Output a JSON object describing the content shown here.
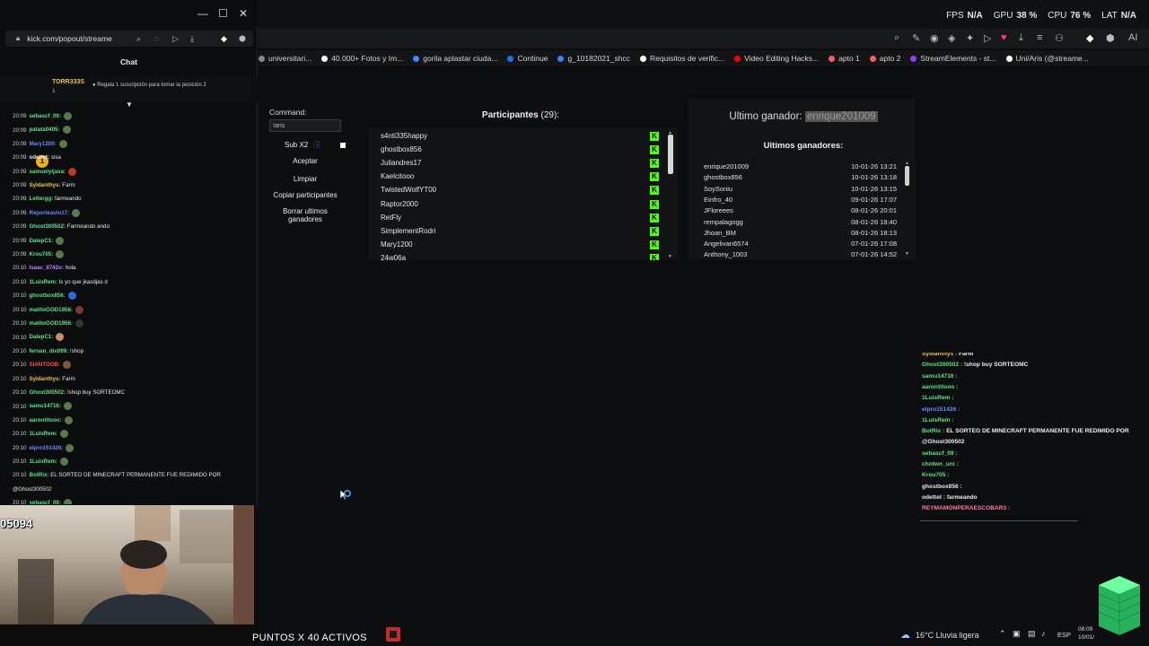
{
  "perf": [
    {
      "label": "FPS",
      "value": "N/A"
    },
    {
      "label": "GPU",
      "value": "38 %"
    },
    {
      "label": "CPU",
      "value": "76 %"
    },
    {
      "label": "LAT",
      "value": "N/A"
    }
  ],
  "bookmarks": [
    {
      "label": "universitari...",
      "color": "#888888"
    },
    {
      "label": "40.000+ Fotos y Im...",
      "color": "#ffffff"
    },
    {
      "label": "gorila aplastar ciuda...",
      "color": "#4285f4"
    },
    {
      "label": "Continue",
      "color": "#1a73e8"
    },
    {
      "label": "g_10182021_shcc",
      "color": "#3b82f6"
    },
    {
      "label": "Requisitos de verific...",
      "color": "#ffffff"
    },
    {
      "label": "Video Editing Hacks...",
      "color": "#ff0000"
    },
    {
      "label": "apto 1",
      "color": "#ff5a5f"
    },
    {
      "label": "apto 2",
      "color": "#ff5a5f"
    },
    {
      "label": "StreamElements - st...",
      "color": "#8a3ffc"
    },
    {
      "label": "Uni/Aris (@streame...",
      "color": "#ffffff"
    }
  ],
  "popup": {
    "url": "kick.com/popout/streame",
    "chat_title": "Chat",
    "pinned": {
      "user": "TORR333S",
      "count": "1",
      "message": "Regala 1 suscripción para tomar la posición 2"
    },
    "messages": [
      {
        "time": "20:09",
        "user": "sebascf_09:",
        "msg": "",
        "color": "#5de28a",
        "emote": "#5a7a4a"
      },
      {
        "time": "20:09",
        "user": "patata0405:",
        "msg": "",
        "color": "#5de28a",
        "emote": "#5a7a4a"
      },
      {
        "time": "20:09",
        "user": "Mary1200:",
        "msg": "",
        "color": "#6b8cff",
        "emote": "#5a7a4a"
      },
      {
        "time": "20:09",
        "user": "odettet:",
        "msg": "sisa",
        "color": "#e8e8e8",
        "emote": ""
      },
      {
        "time": "20:09",
        "user": "samuelyljava:",
        "msg": "",
        "color": "#5de28a",
        "emote": "#c0392b"
      },
      {
        "time": "20:09",
        "user": "Syldanthys:",
        "msg": "Farm",
        "color": "#e8c24a",
        "emote": ""
      },
      {
        "time": "20:09",
        "user": "Lettergg:",
        "msg": "farmeando",
        "color": "#5de28a",
        "emote": ""
      },
      {
        "time": "20:09",
        "user": "Reporteavio17:",
        "msg": "",
        "color": "#6b8cff",
        "emote": "#5a7a4a"
      },
      {
        "time": "20:09",
        "user": "Ghost300502:",
        "msg": "Farmeando ando",
        "color": "#5de28a",
        "emote": ""
      },
      {
        "time": "20:09",
        "user": "DalepC1:",
        "msg": "",
        "color": "#5de28a",
        "emote": "#5a7a4a"
      },
      {
        "time": "20:09",
        "user": "Krou705:",
        "msg": "",
        "color": "#5de28a",
        "emote": "#5a7a4a"
      },
      {
        "time": "20:10",
        "user": "Isaac_8742o:",
        "msg": "hola",
        "color": "#c084fc",
        "emote": ""
      },
      {
        "time": "20:10",
        "user": "1LuisRem:",
        "msg": "ls yo que jkasdjas d",
        "color": "#5de28a",
        "emote": ""
      },
      {
        "time": "20:10",
        "user": "ghostbox856:",
        "msg": "",
        "color": "#5de28a",
        "emote": "#2a6bd6"
      },
      {
        "time": "20:10",
        "user": "matitoGOD1956:",
        "msg": "",
        "color": "#5de28a",
        "emote": "#7a3b2e"
      },
      {
        "time": "20:10",
        "user": "matitoGOD1956:",
        "msg": "",
        "color": "#5de28a",
        "emote": "#333333"
      },
      {
        "time": "20:10",
        "user": "DalepC1:",
        "msg": "",
        "color": "#5de28a",
        "emote": "#c98b6b"
      },
      {
        "time": "20:10",
        "user": "fernan_dix099:",
        "msg": "!shop",
        "color": "#5de28a",
        "emote": ""
      },
      {
        "time": "20:10",
        "user": "SIANTOOB:",
        "msg": "",
        "color": "#ff4d4d",
        "emote": "#7a5a3a"
      },
      {
        "time": "20:10",
        "user": "Syldanthys:",
        "msg": "Farm",
        "color": "#e8c24a",
        "emote": ""
      },
      {
        "time": "20:10",
        "user": "Ghost300502:",
        "msg": "!shop buy SORTEOMC",
        "color": "#5de28a",
        "emote": ""
      },
      {
        "time": "20:10",
        "user": "samu14716:",
        "msg": "",
        "color": "#5de28a",
        "emote": "#5a7a4a"
      },
      {
        "time": "20:10",
        "user": "aarontitooo:",
        "msg": "",
        "color": "#5de28a",
        "emote": "#5a7a4a"
      },
      {
        "time": "20:10",
        "user": "1LuisRem:",
        "msg": "",
        "color": "#5de28a",
        "emote": "#5a7a4a"
      },
      {
        "time": "20:10",
        "user": "elpro151426:",
        "msg": "",
        "color": "#6b8cff",
        "emote": "#5a7a4a"
      },
      {
        "time": "20:10",
        "user": "1LuisRem:",
        "msg": "",
        "color": "#5de28a",
        "emote": "#5a7a4a"
      },
      {
        "time": "20:10",
        "user": "BotRix:",
        "msg": "EL SORTEO DE MINECRAFT PERMANENTE FUE REDIMIDO POR",
        "color": "#5de28a",
        "emote": ""
      },
      {
        "time": "",
        "user": "",
        "msg": "@Ghost300502",
        "color": "#e8e8e8",
        "emote": ""
      },
      {
        "time": "20:10",
        "user": "sebascf_09:",
        "msg": "",
        "color": "#5de28a",
        "emote": "#5a7a4a"
      }
    ]
  },
  "webcam": {
    "counter": "05094"
  },
  "app": {
    "command_label": "Command:",
    "command_value": "!aris",
    "sub_label": "Sub X2",
    "buttons": [
      "Aceptar",
      "Limpiar",
      "Copiar participantes",
      "Borrar ultimos ganadores"
    ],
    "participants_title": "Participantes",
    "participants_count": "(29):",
    "participants": [
      "s4nti335happy",
      "ghostbox856",
      "Juliandres17",
      "Kaelcitooo",
      "TwistedWolfYT00",
      "Raptor2000",
      "RetFly",
      "SimplementRodri",
      "Mary1200",
      "24w06a"
    ],
    "kick_badge": "K",
    "last_winner_label": "Ultimo ganador:",
    "last_winner": "enrique201009",
    "last_winners_title": "Ultimos ganadores:",
    "winners": [
      {
        "name": "enrique201009",
        "date": "10-01-26 13:21"
      },
      {
        "name": "ghostbox856",
        "date": "10-01-26 13:18"
      },
      {
        "name": "SoySoniu",
        "date": "10-01-26 13:15"
      },
      {
        "name": "Einfro_40",
        "date": "09-01-26 17:07"
      },
      {
        "name": "JFloreees",
        "date": "08-01-26 20:01"
      },
      {
        "name": "rempalagogg",
        "date": "08-01-26 18:40"
      },
      {
        "name": "Jhoan_BM",
        "date": "08-01-26 18:13"
      },
      {
        "name": "Angelivan6574",
        "date": "07-01-26 17:08"
      },
      {
        "name": "Anthony_1003",
        "date": "07-01-26 14:52"
      }
    ]
  },
  "overlay_chat": [
    {
      "user": "Syldanthys :",
      "msg": "Farm",
      "color": "#e8c24a"
    },
    {
      "user": "Ghost300502 :",
      "msg": "!shop buy SORTEOMC",
      "color": "#5de28a"
    },
    {
      "user": "samu14716 :",
      "msg": "",
      "color": "#5de28a"
    },
    {
      "user": "aarontitooo :",
      "msg": "",
      "color": "#5de28a"
    },
    {
      "user": "1LuisRem :",
      "msg": "",
      "color": "#5de28a"
    },
    {
      "user": "elpro151426 :",
      "msg": "",
      "color": "#6b8cff"
    },
    {
      "user": "1LuisRem :",
      "msg": "",
      "color": "#5de28a"
    },
    {
      "user": "BotRix :",
      "msg": "EL SORTEO DE MINECRAFT PERMANENTE FUE REDIMIDO POR",
      "color": "#5de28a"
    },
    {
      "user": "",
      "msg": "@Ghost300502",
      "color": "#e8e8e8"
    },
    {
      "user": "sebascf_09 :",
      "msg": "",
      "color": "#5de28a"
    },
    {
      "user": "chntwn_uni :",
      "msg": "",
      "color": "#5de28a"
    },
    {
      "user": "Krou705 :",
      "msg": "",
      "color": "#5de28a"
    },
    {
      "user": "ghostbox856 :",
      "msg": "",
      "color": "#e8e8e8"
    },
    {
      "user": "odettet :",
      "msg": "farmeando",
      "color": "#e8e8e8"
    },
    {
      "user": "REYMAMONPERAESCOBAR3 :",
      "msg": "",
      "color": "#ff7aa8"
    }
  ],
  "taskbar": {
    "puntos": "PUNTOS X 40 ACTIVOS",
    "weather": "16°C  Lluvia ligera",
    "lang": "ESP",
    "time": "08:09",
    "date": "10/01/"
  }
}
